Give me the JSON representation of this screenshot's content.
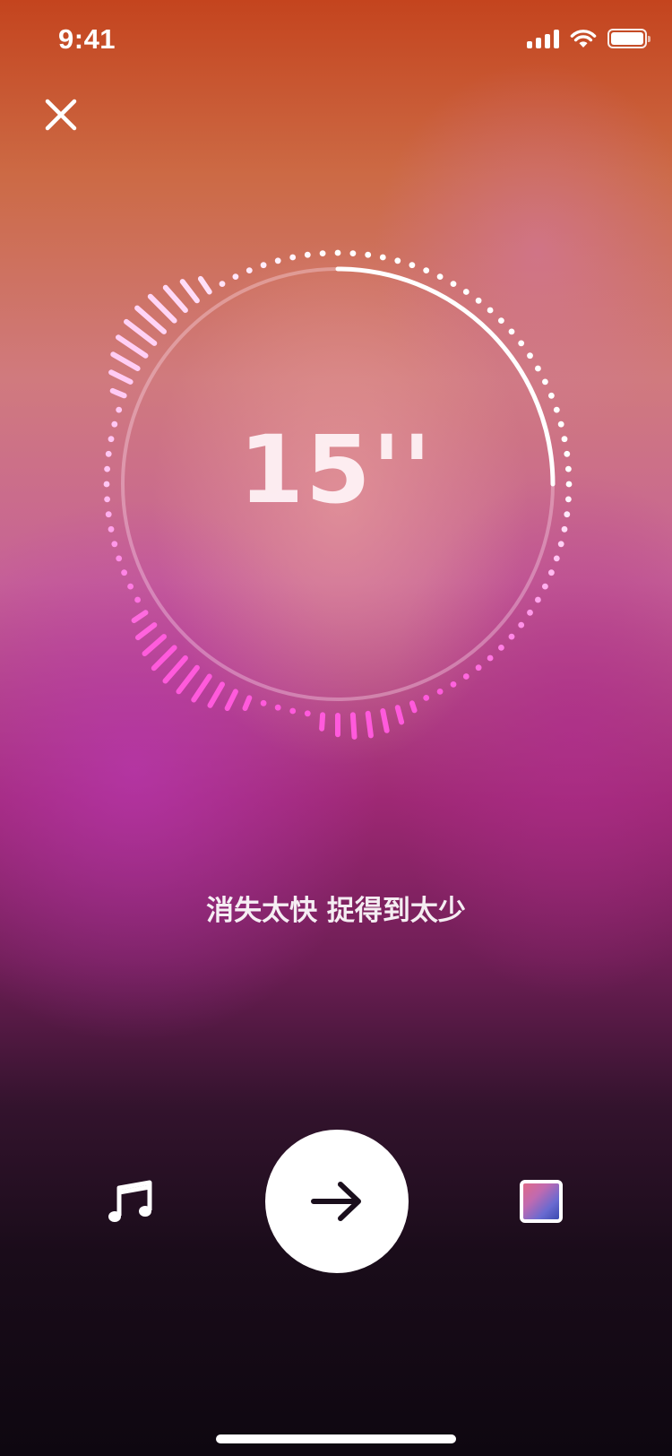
{
  "status_bar": {
    "time": "9:41",
    "icons": [
      "cellular-signal-icon",
      "wifi-icon",
      "battery-icon"
    ]
  },
  "toolbar": {
    "close_icon": "close-icon"
  },
  "timer": {
    "display": "15''",
    "remaining_fraction": 0.25
  },
  "hint": {
    "text": "消失太快  捉得到太少"
  },
  "bottom_bar": {
    "music_icon": "music-note-icon",
    "next_icon": "arrow-right-icon",
    "gallery_icon": "gallery-thumbnail-icon"
  },
  "colors": {
    "accent_pink": "#ff5bd8",
    "progress_arc": "#ffffff"
  }
}
